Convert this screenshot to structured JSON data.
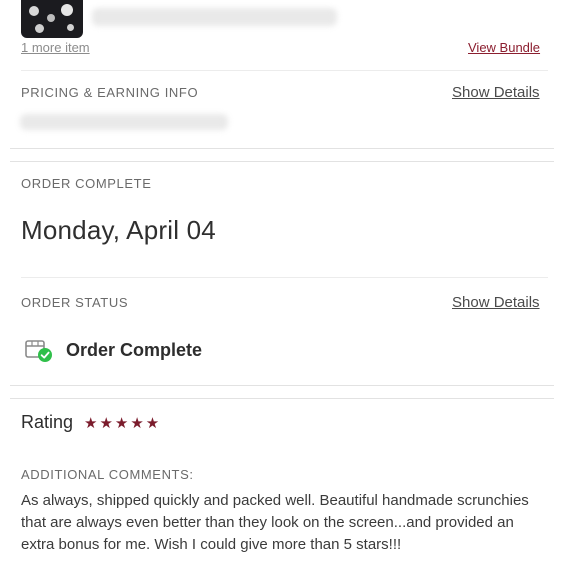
{
  "bundle": {
    "more_items_link": "1 more item",
    "view_bundle_link": "View Bundle"
  },
  "pricing": {
    "label": "PRICING & EARNING INFO",
    "show_details": "Show Details"
  },
  "order_complete": {
    "label": "ORDER COMPLETE",
    "date": "Monday, April 04"
  },
  "order_status": {
    "label": "ORDER STATUS",
    "show_details": "Show Details",
    "status_text": "Order Complete",
    "status_icon": "box-check-icon"
  },
  "rating": {
    "label": "Rating",
    "stars": "★★★★★",
    "value": 5,
    "max": 5
  },
  "comments": {
    "label": "ADDITIONAL COMMENTS:",
    "text": "As always, shipped quickly and packed well. Beautiful handmade scrunchies that are always even better than they look on the screen...and provided an extra bonus for me. Wish I could give more than 5 stars!!!"
  },
  "colors": {
    "accent": "#8b1e2f",
    "star": "#7b1c2c",
    "check": "#2fbf4a"
  }
}
